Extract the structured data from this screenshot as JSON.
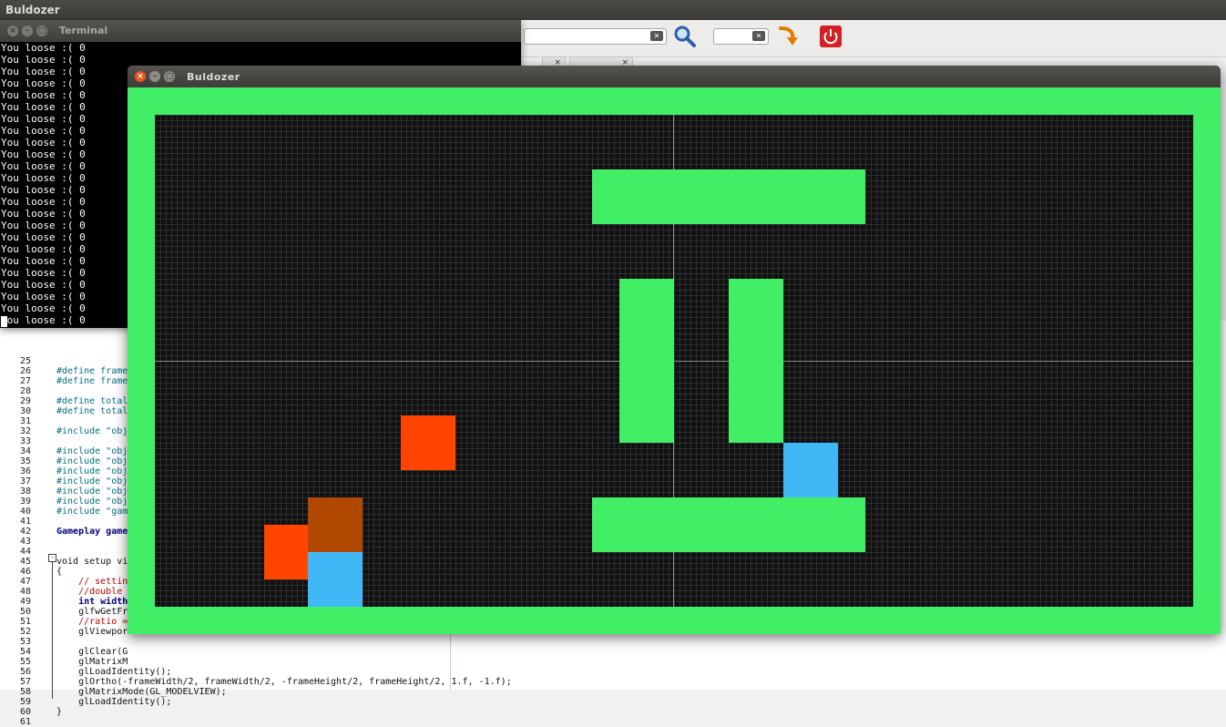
{
  "desktop": {
    "title": "Buldozer"
  },
  "ide": {
    "search_placeholder": "",
    "goto_placeholder": "",
    "clear_icon": "clear-icon",
    "search_icon": "magnifier-icon",
    "jump_icon": "jump-arrow-icon",
    "power_icon": "power-icon",
    "tab1_close": "×",
    "tab2_close": "×",
    "code_lines": [
      {
        "n": "25",
        "t": ""
      },
      {
        "n": "26",
        "t": "#define frame"
      },
      {
        "n": "27",
        "t": "#define frame"
      },
      {
        "n": "28",
        "t": ""
      },
      {
        "n": "29",
        "t": "#define total"
      },
      {
        "n": "30",
        "t": "#define total"
      },
      {
        "n": "31",
        "t": ""
      },
      {
        "n": "32",
        "t": "#include \"obj"
      },
      {
        "n": "33",
        "t": ""
      },
      {
        "n": "34",
        "t": "#include \"obj"
      },
      {
        "n": "35",
        "t": "#include \"obj"
      },
      {
        "n": "36",
        "t": "#include \"obj"
      },
      {
        "n": "37",
        "t": "#include \"obj"
      },
      {
        "n": "38",
        "t": "#include \"obj"
      },
      {
        "n": "39",
        "t": "#include \"obj"
      },
      {
        "n": "40",
        "t": "#include \"gam"
      },
      {
        "n": "41",
        "t": ""
      },
      {
        "n": "42",
        "t": "Gameplay game"
      },
      {
        "n": "43",
        "t": ""
      },
      {
        "n": "44",
        "t": ""
      },
      {
        "n": "45",
        "t": "void setup vi"
      },
      {
        "n": "46",
        "t": "{"
      },
      {
        "n": "47",
        "t": "    // settin"
      },
      {
        "n": "48",
        "t": "    //double"
      },
      {
        "n": "49",
        "t": "    int width"
      },
      {
        "n": "50",
        "t": "    glfwGetFr"
      },
      {
        "n": "51",
        "t": "    //ratio ="
      },
      {
        "n": "52",
        "t": "    glViewpor"
      },
      {
        "n": "53",
        "t": ""
      },
      {
        "n": "54",
        "t": "    glClear(G"
      },
      {
        "n": "55",
        "t": "    glMatrixM"
      },
      {
        "n": "56",
        "t": "    glLoadIdentity();"
      },
      {
        "n": "57",
        "t": "    glOrtho(-frameWidth/2, frameWidth/2, -frameHeight/2, frameHeight/2, 1.f, -1.f);"
      },
      {
        "n": "58",
        "t": "    glMatrixMode(GL_MODELVIEW);"
      },
      {
        "n": "59",
        "t": "    glLoadIdentity();"
      },
      {
        "n": "60",
        "t": "}"
      },
      {
        "n": "61",
        "t": ""
      }
    ]
  },
  "terminal": {
    "title": "Terminal",
    "lines": [
      "You loose :( 0",
      "You loose :( 0",
      "You loose :( 0",
      "You loose :( 0",
      "You loose :( 0",
      "You loose :( 0",
      "You loose :( 0",
      "You loose :( 0",
      "You loose :( 0",
      "You loose :( 0",
      "You loose :( 0",
      "You loose :( 0",
      "You loose :( 0",
      "You loose :( 0",
      "You loose :( 0",
      "You loose :( 0",
      "You loose :( 0",
      "You loose :( 0",
      "You loose :( 0",
      "You loose :( 0",
      "You loose :( 0",
      "You loose :( 0",
      "You loose :( 0",
      "You loose :( 0"
    ]
  },
  "game": {
    "title": "Buldozer",
    "colors": {
      "wall": "#41ef67",
      "background": "#111111",
      "target": "#ff4500",
      "box": "#b04800",
      "player": "#40b8f5"
    }
  },
  "window_buttons": {
    "close": "×",
    "minimize": "–",
    "maximize": "□"
  }
}
